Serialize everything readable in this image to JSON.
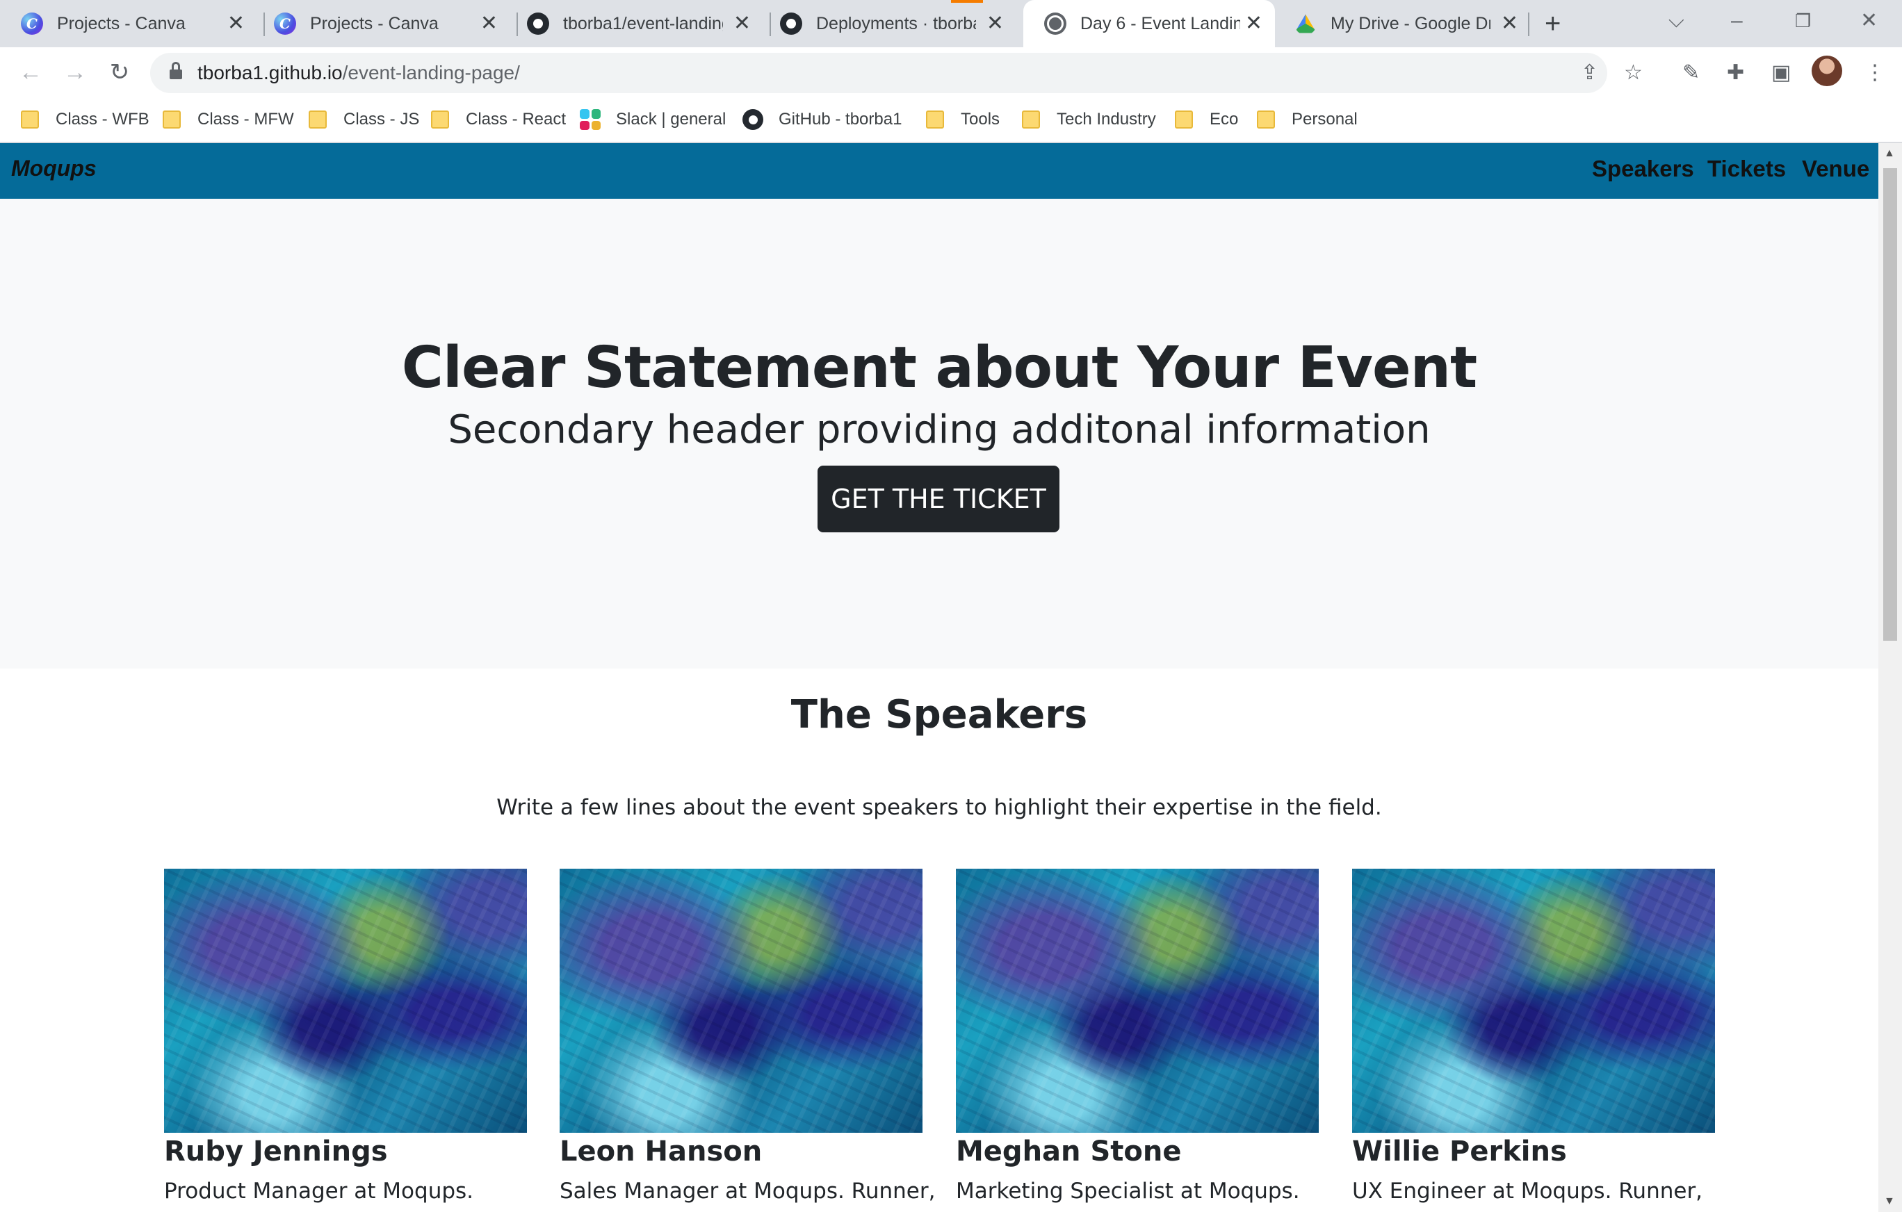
{
  "browser": {
    "tabs": [
      {
        "title": "Projects - Canva",
        "icon": "canva-icon",
        "active": false
      },
      {
        "title": "Projects - Canva",
        "icon": "canva-icon",
        "active": false
      },
      {
        "title": "tborba1/event-landing",
        "icon": "github-icon",
        "active": false
      },
      {
        "title": "Deployments · tborba",
        "icon": "github-icon",
        "active": false
      },
      {
        "title": "Day 6 - Event Landing",
        "icon": "globe-icon",
        "active": true
      },
      {
        "title": "My Drive - Google Dri",
        "icon": "google-drive-icon",
        "active": false
      }
    ],
    "url_host": "tborba1.github.io",
    "url_path": "/event-landing-page/",
    "bookmarks": [
      {
        "label": "Class - WFB",
        "icon": "folder-icon"
      },
      {
        "label": "Class - MFW",
        "icon": "folder-icon"
      },
      {
        "label": "Class - JS",
        "icon": "folder-icon"
      },
      {
        "label": "Class - React",
        "icon": "folder-icon"
      },
      {
        "label": "Slack | general",
        "icon": "slack-icon"
      },
      {
        "label": "GitHub - tborba1",
        "icon": "github-icon"
      },
      {
        "label": "Tools",
        "icon": "folder-icon"
      },
      {
        "label": "Tech Industry",
        "icon": "folder-icon"
      },
      {
        "label": "Eco",
        "icon": "folder-icon"
      },
      {
        "label": "Personal",
        "icon": "folder-icon"
      }
    ]
  },
  "site": {
    "brand": "Moqups",
    "nav": [
      "Speakers",
      "Tickets",
      "Venue"
    ],
    "nav_color": "#056b99",
    "hero": {
      "title": "Clear Statement about Your Event",
      "subtitle": "Secondary header providing additonal information",
      "cta": "GET THE TICKET"
    },
    "speakers": {
      "title": "The Speakers",
      "intro": "Write a few lines about the event speakers to highlight their expertise in the field.",
      "cards": [
        {
          "name": "Ruby Jennings",
          "role": "Product Manager at Moqups."
        },
        {
          "name": "Leon Hanson",
          "role": "Sales Manager at Moqups. Runner,"
        },
        {
          "name": "Meghan Stone",
          "role": "Marketing Specialist at Moqups."
        },
        {
          "name": "Willie Perkins",
          "role": "UX Engineer at Moqups. Runner,"
        }
      ]
    }
  }
}
